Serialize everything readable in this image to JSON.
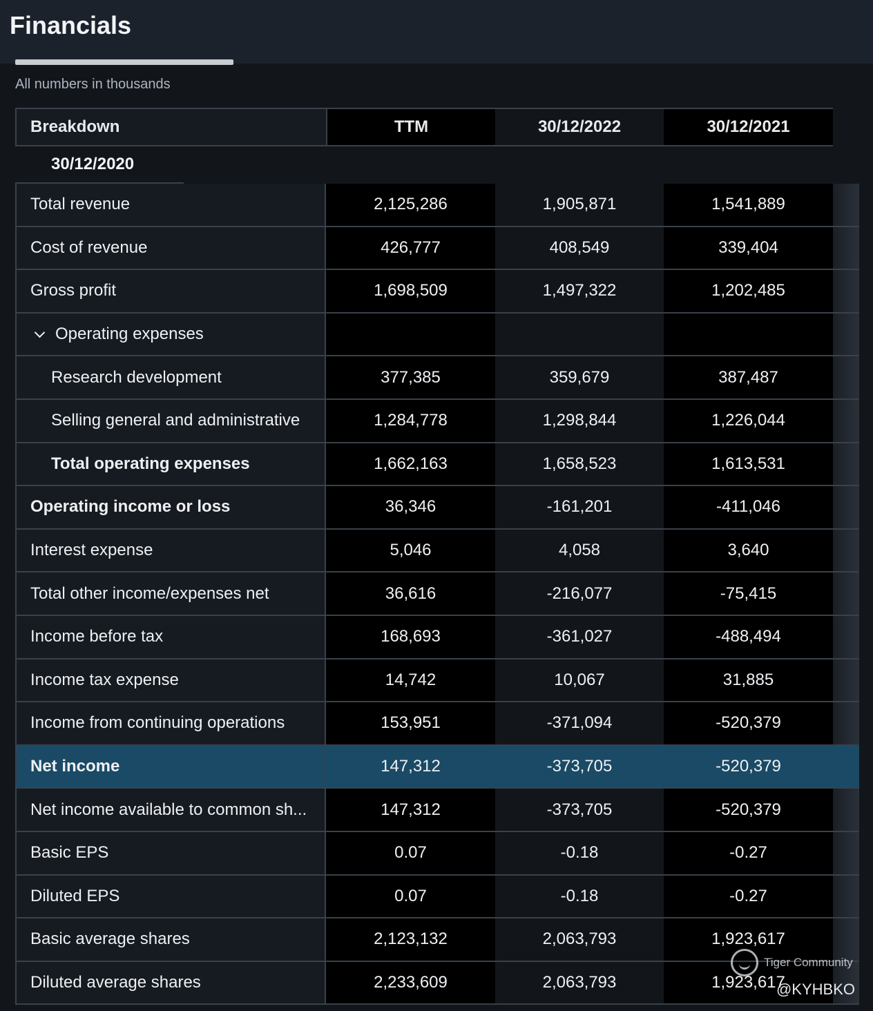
{
  "header": {
    "title": "Financials"
  },
  "subtitle": "All numbers in thousands",
  "table": {
    "columns": [
      "Breakdown",
      "TTM",
      "30/12/2022",
      "30/12/2021"
    ],
    "wrapped_column": "30/12/2020",
    "rows": [
      {
        "label": "Total revenue",
        "ttm": "2,125,286",
        "y2022": "1,905,871",
        "y2021": "1,541,889"
      },
      {
        "label": "Cost of revenue",
        "ttm": "426,777",
        "y2022": "408,549",
        "y2021": "339,404"
      },
      {
        "label": "Gross profit",
        "ttm": "1,698,509",
        "y2022": "1,497,322",
        "y2021": "1,202,485"
      },
      {
        "label": "Operating expenses",
        "ttm": "",
        "y2022": "",
        "y2021": ""
      },
      {
        "label": "Research development",
        "ttm": "377,385",
        "y2022": "359,679",
        "y2021": "387,487"
      },
      {
        "label": "Selling general and administrative",
        "ttm": "1,284,778",
        "y2022": "1,298,844",
        "y2021": "1,226,044"
      },
      {
        "label": "Total operating expenses",
        "ttm": "1,662,163",
        "y2022": "1,658,523",
        "y2021": "1,613,531"
      },
      {
        "label": "Operating income or loss",
        "ttm": "36,346",
        "y2022": "-161,201",
        "y2021": "-411,046"
      },
      {
        "label": "Interest expense",
        "ttm": "5,046",
        "y2022": "4,058",
        "y2021": "3,640"
      },
      {
        "label": "Total other income/expenses net",
        "ttm": "36,616",
        "y2022": "-216,077",
        "y2021": "-75,415"
      },
      {
        "label": "Income before tax",
        "ttm": "168,693",
        "y2022": "-361,027",
        "y2021": "-488,494"
      },
      {
        "label": "Income tax expense",
        "ttm": "14,742",
        "y2022": "10,067",
        "y2021": "31,885"
      },
      {
        "label": "Income from continuing operations",
        "ttm": "153,951",
        "y2022": "-371,094",
        "y2021": "-520,379"
      },
      {
        "label": "Net income",
        "ttm": "147,312",
        "y2022": "-373,705",
        "y2021": "-520,379"
      },
      {
        "label": "Net income available to common sh...",
        "ttm": "147,312",
        "y2022": "-373,705",
        "y2021": "-520,379"
      },
      {
        "label": "Basic EPS",
        "ttm": "0.07",
        "y2022": "-0.18",
        "y2021": "-0.27"
      },
      {
        "label": "Diluted EPS",
        "ttm": "0.07",
        "y2022": "-0.18",
        "y2021": "-0.27"
      },
      {
        "label": "Basic average shares",
        "ttm": "2,123,132",
        "y2022": "2,063,793",
        "y2021": "1,923,617"
      },
      {
        "label": "Diluted average shares",
        "ttm": "2,233,609",
        "y2022": "2,063,793",
        "y2021": "1,923,617"
      }
    ]
  },
  "watermark": {
    "brand": "Tiger Community",
    "handle": "@KYHBKO"
  },
  "colors": {
    "background": "#12161b",
    "highlight": "#1a4a66",
    "topbar": "#1b222b"
  },
  "icons": {
    "expand": "chevron-down-icon",
    "brand": "tiger-logo-icon"
  }
}
